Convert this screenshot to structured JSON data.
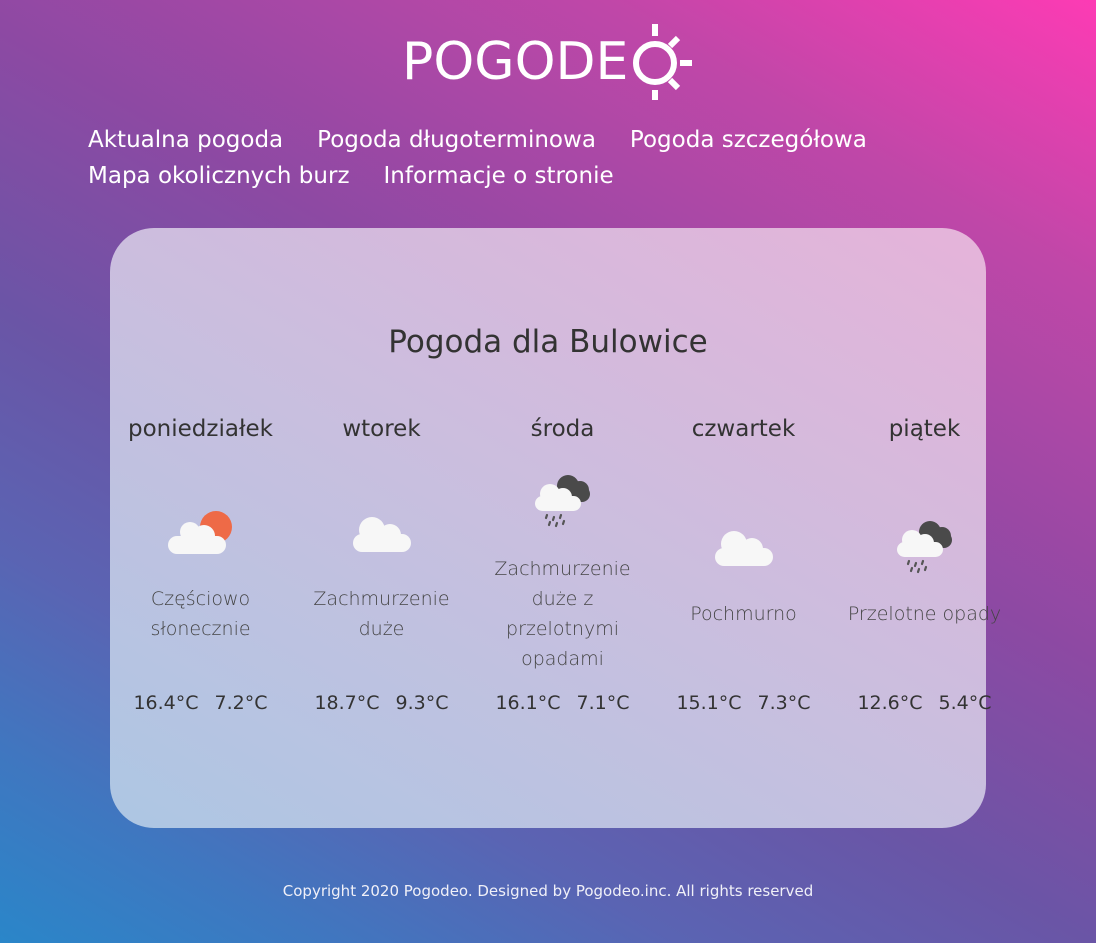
{
  "brand": {
    "logo_text": "POGODE"
  },
  "nav": {
    "row1": [
      "Aktualna pogoda",
      "Pogoda długoterminowa",
      "Pogoda szczegółowa"
    ],
    "row2": [
      "Mapa okolicznych burz",
      "Informacje o stronie"
    ]
  },
  "card": {
    "title": "Pogoda dla Bulowice",
    "days": [
      {
        "name": "poniedziałek",
        "icon": "partly-sunny-icon",
        "desc": [
          "Częściowo",
          "słonecznie"
        ],
        "max": "16.4°C",
        "min": "7.2°C"
      },
      {
        "name": "wtorek",
        "icon": "cloud-icon",
        "desc": [
          "Zachmurzenie",
          "duże"
        ],
        "max": "18.7°C",
        "min": "9.3°C"
      },
      {
        "name": "środa",
        "icon": "rain-cloud-icon",
        "desc": [
          "Zachmurzenie",
          "duże z",
          "przelotnymi",
          "opadami"
        ],
        "max": "16.1°C",
        "min": "7.1°C"
      },
      {
        "name": "czwartek",
        "icon": "cloud-icon",
        "desc": [
          "Pochmurno"
        ],
        "max": "15.1°C",
        "min": "7.3°C"
      },
      {
        "name": "piątek",
        "icon": "rain-cloud-icon",
        "desc": [
          "Przelotne opady"
        ],
        "max": "12.6°C",
        "min": "5.4°C"
      }
    ]
  },
  "footer": {
    "text": "Copyright 2020 Pogodeo. Designed by Pogodeo.inc. All rights reserved"
  },
  "colors": {
    "sun": "#ee6a47",
    "cloud": "#f7f7f7",
    "dark_cloud": "#4a4a4a",
    "rain": "#555555"
  }
}
